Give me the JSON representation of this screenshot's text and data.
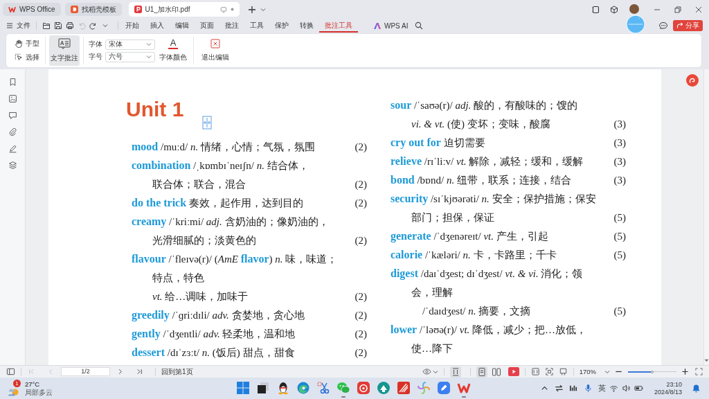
{
  "tabs": [
    {
      "kind": "home",
      "label": "WPS Office",
      "selected": false
    },
    {
      "kind": "template",
      "label": "找稻壳模板",
      "selected": false
    },
    {
      "kind": "pdf",
      "label": "U1_加水印.pdf",
      "selected": true
    }
  ],
  "menu": {
    "file": "文件",
    "quick_tools": [
      {
        "kind": "open",
        "disabled": false
      },
      {
        "kind": "save",
        "disabled": false
      },
      {
        "kind": "print",
        "disabled": false
      },
      {
        "kind": "undo",
        "disabled": true
      },
      {
        "kind": "redo",
        "disabled": false
      },
      {
        "kind": "more",
        "disabled": false
      }
    ],
    "items": [
      {
        "label": "开始",
        "selected": false
      },
      {
        "label": "插入",
        "selected": false
      },
      {
        "label": "编辑",
        "selected": false
      },
      {
        "label": "页面",
        "selected": false
      },
      {
        "label": "批注",
        "selected": false
      },
      {
        "label": "工具",
        "selected": false
      },
      {
        "label": "保护",
        "selected": false
      },
      {
        "label": "转换",
        "selected": false
      },
      {
        "label": "批注工具",
        "selected": true
      }
    ],
    "ai": "WPS AI",
    "share": "分享"
  },
  "ribbon": {
    "modes": [
      {
        "kind": "hand",
        "label": "手型"
      },
      {
        "kind": "select",
        "label": "选择"
      }
    ],
    "text_annotation": {
      "label": "文字批注",
      "selected": true
    },
    "font": {
      "label": "字体",
      "value": "宋体"
    },
    "size": {
      "label": "字号",
      "value": "六号"
    },
    "font_color": {
      "glyph": "A",
      "label": "字体颜色"
    },
    "exit": "退出编辑"
  },
  "document": {
    "title": "Unit 1",
    "columns": [
      {
        "lines": [
          {
            "kind": "entry",
            "text": "**mood** /muːd/ *n.* 情绪，心情；气氛，氛围",
            "number": "(2)"
          },
          {
            "kind": "entry",
            "text": "**combination** /ˌkɒmbɪˈneɪʃn/ *n.* 结合体，"
          },
          {
            "kind": "continuation",
            "text": "联合体；联合，混合",
            "number": "(2)"
          },
          {
            "kind": "entry",
            "text": "**do the trick** 奏效，起作用，达到目的",
            "number": "(2)"
          },
          {
            "kind": "entry",
            "text": "**creamy** /ˈkriːmi/ *adj.* 含奶油的；像奶油的，"
          },
          {
            "kind": "continuation",
            "text": "光滑细腻的；淡黄色的",
            "number": "(2)"
          },
          {
            "kind": "entry",
            "text": "**flavour** /ˈfleɪvə(r)/ (*AmE* **flavor**) *n.* 味，味道；"
          },
          {
            "kind": "continuation",
            "text": "特点，特色"
          },
          {
            "kind": "continuation",
            "text": "*vt.* 给…调味，加味于",
            "number": "(2)"
          },
          {
            "kind": "entry",
            "text": "**greedily** /ˈɡriːdɪli/ *adv.* 贪婪地，贪心地",
            "number": "(2)"
          },
          {
            "kind": "entry",
            "text": "**gently** /ˈdʒentli/ *adv.* 轻柔地，温和地",
            "number": "(2)"
          },
          {
            "kind": "entry",
            "text": "**dessert** /dɪˈzɜːt/ *n.* (饭后) 甜点，甜食",
            "number": "(2)"
          }
        ]
      },
      {
        "lines": [
          {
            "kind": "entry",
            "text": "**sour** /ˈsaʊə(r)/ *adj.* 酸的，有酸味的；馊的"
          },
          {
            "kind": "continuation",
            "text": "*vi. & vt.* (使) 变坏；变味，酸腐",
            "number": "(3)"
          },
          {
            "kind": "entry",
            "text": "**cry out for** 迫切需要",
            "number": "(3)"
          },
          {
            "kind": "entry",
            "text": "**relieve** /rɪˈliːv/ *vt.* 解除，减轻；缓和，缓解",
            "number": "(3)"
          },
          {
            "kind": "entry",
            "text": "**bond** /bɒnd/ *n.* 纽带，联系；连接，结合",
            "number": "(3)"
          },
          {
            "kind": "entry",
            "text": "**security** /sɪˈkjʊərəti/ *n.* 安全；保护措施；保安"
          },
          {
            "kind": "continuation",
            "text": "部门；担保，保证",
            "number": "(5)"
          },
          {
            "kind": "entry",
            "text": "**generate** /ˈdʒenəreɪt/ *vt.* 产生，引起",
            "number": "(5)"
          },
          {
            "kind": "entry",
            "text": "**calorie** /ˈkæləri/ *n.* 卡，卡路里；千卡",
            "number": "(5)"
          },
          {
            "kind": "entry",
            "text": "**digest** /daɪˈdʒest; dɪˈdʒest/ *vt. & vi.* 消化；领"
          },
          {
            "kind": "continuation",
            "text": "会，理解"
          },
          {
            "kind": "subentry",
            "text": "/ˈdaɪdʒest/ *n.* 摘要，文摘",
            "number": "(5)"
          },
          {
            "kind": "entry",
            "text": "**lower** /ˈləʊə(r)/ *vt.* 降低，减少；把…放低，"
          },
          {
            "kind": "continuation",
            "text": "使…降下"
          }
        ]
      }
    ]
  },
  "status_bar": {
    "nav": [
      {
        "kind": "first",
        "disabled": true
      },
      {
        "kind": "prev",
        "disabled": true
      },
      {
        "kind": "next",
        "disabled": false
      },
      {
        "kind": "last",
        "disabled": false
      }
    ],
    "page": "1/2",
    "back_to_first": "回到第1页",
    "views": [
      {
        "kind": "continuous",
        "selected": true
      },
      {
        "kind": "single",
        "selected": true
      },
      {
        "kind": "double",
        "selected": false
      }
    ],
    "zoom": "170%",
    "zoom_slider": {
      "level": 0.5
    }
  },
  "taskbar": {
    "weather": {
      "badge": "1",
      "temperature": "27°C",
      "condition": "局部多云"
    },
    "apps": [
      {
        "kind": "start",
        "open": false
      },
      {
        "kind": "task-view",
        "open": false
      },
      {
        "kind": "qq",
        "open": false
      },
      {
        "kind": "edge",
        "open": false
      },
      {
        "kind": "snip",
        "open": false
      },
      {
        "kind": "wechat",
        "open": true
      },
      {
        "kind": "netease",
        "open": false
      },
      {
        "kind": "arrow",
        "open": false
      },
      {
        "kind": "stripes",
        "open": false
      },
      {
        "kind": "pinwheel",
        "open": false
      },
      {
        "kind": "pen",
        "open": false
      },
      {
        "kind": "wps",
        "open": true
      }
    ],
    "ime": "英",
    "time": "23:10",
    "date": "2024/8/13"
  }
}
